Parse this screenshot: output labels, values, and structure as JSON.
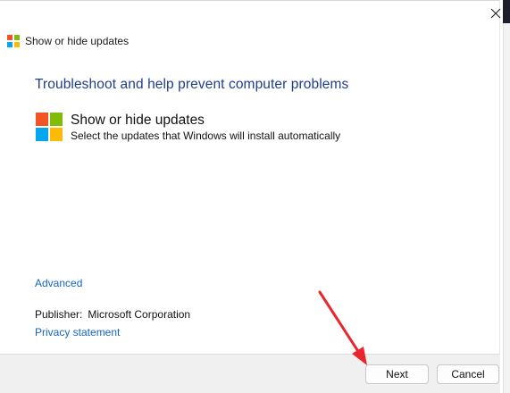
{
  "window": {
    "title": "Show or hide updates",
    "close_icon": "close-icon"
  },
  "content": {
    "heading": "Troubleshoot and help prevent computer problems",
    "tool_name": "Show or hide updates",
    "tool_description": "Select the updates that Windows will install automatically",
    "advanced_link": "Advanced",
    "publisher_label": "Publisher:",
    "publisher_value": "Microsoft Corporation",
    "privacy_link": "Privacy statement"
  },
  "buttons": {
    "next": "Next",
    "cancel": "Cancel"
  },
  "colors": {
    "heading": "#1e3e8a",
    "link": "#1565c0",
    "arrow": "#e8262b",
    "logo": [
      "#f35325",
      "#81bc06",
      "#05a6f0",
      "#ffba08"
    ]
  }
}
